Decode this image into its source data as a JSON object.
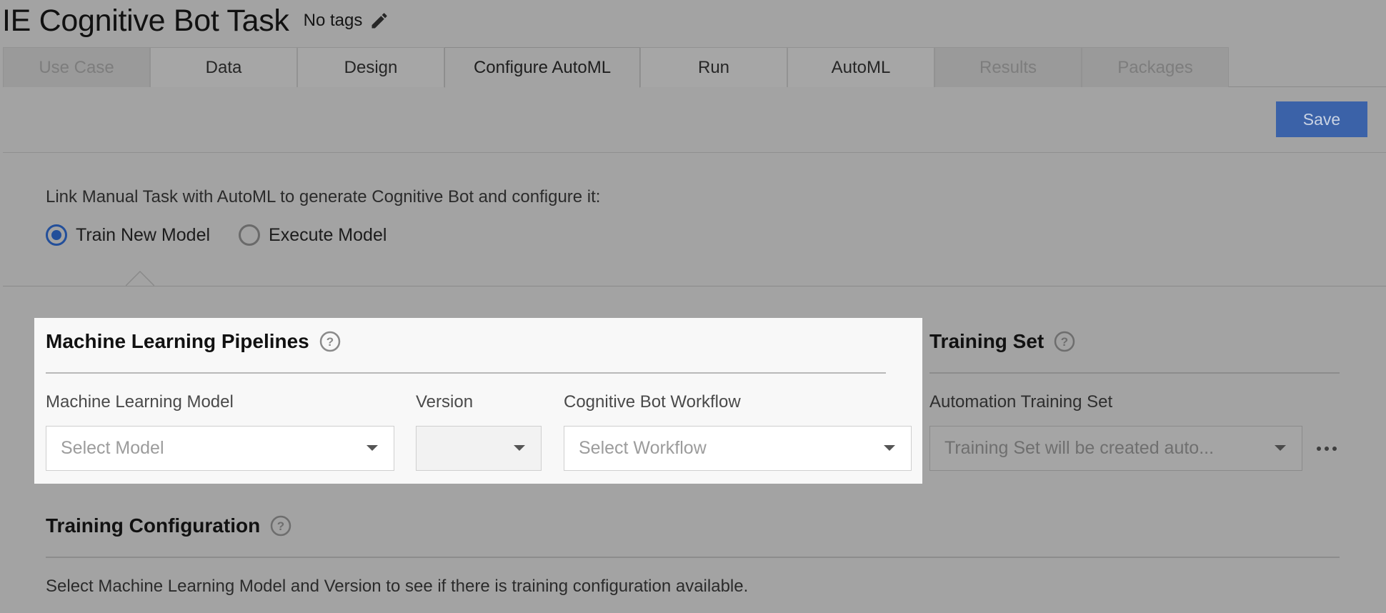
{
  "header": {
    "title": "IE Cognitive Bot Task",
    "tags": "No tags"
  },
  "tabs": [
    {
      "label": "Use Case",
      "state": "disabled"
    },
    {
      "label": "Data",
      "state": "normal"
    },
    {
      "label": "Design",
      "state": "normal"
    },
    {
      "label": "Configure AutoML",
      "state": "active"
    },
    {
      "label": "Run",
      "state": "normal"
    },
    {
      "label": "AutoML",
      "state": "normal"
    },
    {
      "label": "Results",
      "state": "disabled"
    },
    {
      "label": "Packages",
      "state": "disabled"
    }
  ],
  "toolbar": {
    "save_label": "Save"
  },
  "mode": {
    "prompt": "Link Manual Task with AutoML to generate Cognitive Bot and configure it:",
    "options": [
      {
        "label": "Train New Model",
        "checked": true
      },
      {
        "label": "Execute Model",
        "checked": false
      }
    ]
  },
  "ml_pipelines": {
    "title": "Machine Learning Pipelines",
    "model_label": "Machine Learning Model",
    "model_placeholder": "Select Model",
    "version_label": "Version",
    "version_value": "",
    "workflow_label": "Cognitive Bot Workflow",
    "workflow_placeholder": "Select Workflow"
  },
  "training_set": {
    "title": "Training Set",
    "field_label": "Automation Training Set",
    "placeholder": "Training Set will be created auto..."
  },
  "training_config": {
    "title": "Training Configuration",
    "info": "Select Machine Learning Model and Version to see if there is training configuration available."
  },
  "colors": {
    "accent": "#234f9a",
    "save_button": "#3b62a8",
    "overlay": "#a3a3a3",
    "highlight_panel": "#f8f8f8"
  }
}
